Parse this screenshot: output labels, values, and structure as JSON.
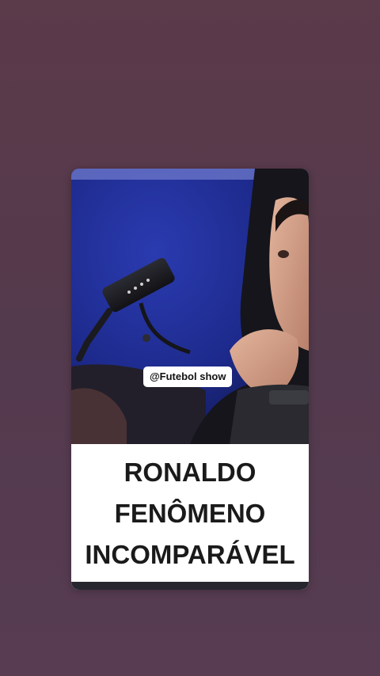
{
  "video": {
    "watermark": "@Futebol show"
  },
  "caption": {
    "lines": [
      "RONALDO",
      "FENÔMENO",
      "INCOMPARÁVEL"
    ]
  },
  "colors": {
    "background": "#573a4c",
    "video_blue": "#1c2a8a",
    "caption_bg": "#ffffff",
    "caption_text": "#1a1a1a"
  }
}
